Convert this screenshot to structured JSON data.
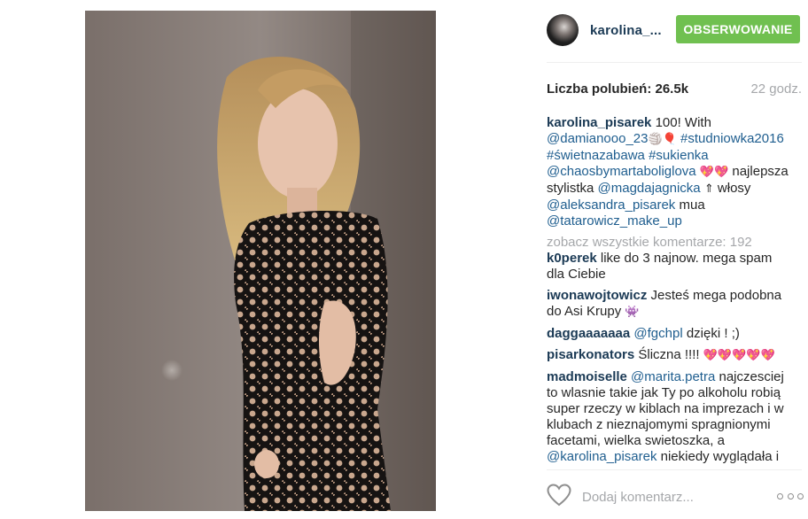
{
  "post": {
    "author": {
      "username_short": "karolina_...",
      "follow_label": "OBSERWOWANIE"
    },
    "likes_label": "Liczba polubień: 26.5k",
    "time_ago": "22 godz.",
    "caption": {
      "username": "karolina_pisarek",
      "text_1": " 100! With",
      "mention_1": "@damianooo_23",
      "emoji_1": "🏐🎈",
      "hashtag_1": "#studniowka2016",
      "hashtag_2": "#świetnazabawa",
      "hashtag_3": "#sukienka",
      "mention_2": "@chaosbymartaboliglova",
      "emoji_2": "💖💖",
      "text_2": " najlepsza",
      "text_3": "stylistka ",
      "mention_3": "@magdajagnicka",
      "emoji_3": "⇑",
      "text_4": " włosy",
      "mention_4": "@aleksandra_pisarek",
      "text_5": " mua",
      "mention_5": "@tatarowicz_make_up"
    },
    "view_all_comments": "zobacz wszystkie komentarze: 192",
    "comments": [
      {
        "username": "k0perek",
        "line1": " like do 3 najnow. mega spam",
        "line2": "dla Ciebie"
      },
      {
        "username": "iwonawojtowicz",
        "line1": " Jesteś mega podobna",
        "line2": "do Asi Krupy ",
        "emoji": "👾"
      },
      {
        "username": "daggaaaaaaa",
        "mention": "@fgchpl",
        "text": " dzięki ! ;)"
      },
      {
        "username": "pisarkonators",
        "text": " Śliczna !!!! ",
        "emoji": "💖💖💖💖💖"
      },
      {
        "username": "madmoiselle",
        "mention": "@marita.petra",
        "line1": " najczesciej",
        "line2": "to wlasnie takie jak Ty po alkoholu robią",
        "line3": "super rzeczy w kiblach na imprezach i w",
        "line4": "klubach z nieznajomymi spragnionymi",
        "line5": "facetami, wielka swietoszka, a",
        "line6_mention": "@karolina_pisarek",
        "line6_text": " niekiedy wyglądała i"
      }
    ],
    "comment_placeholder": "Dodaj komentarz..."
  },
  "icons": {
    "like": "heart-outline-icon",
    "more": "more-options-icon",
    "avatar": "profile-avatar"
  },
  "colors": {
    "follow_button": "#70c050",
    "username": "#1b3a55",
    "mention": "#1f5e8f",
    "muted": "#a5a7aa"
  }
}
